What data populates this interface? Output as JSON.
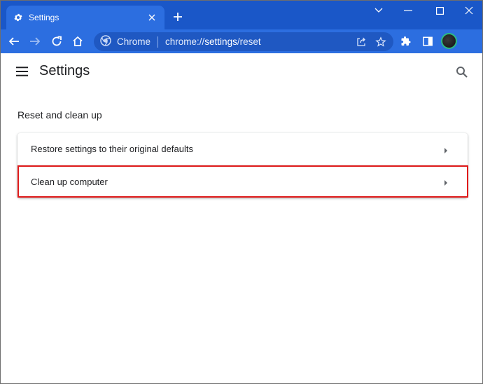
{
  "tab": {
    "title": "Settings",
    "icon": "gear-icon"
  },
  "window_controls": {
    "dropdown": "chevron-down-icon",
    "minimize": "minimize-icon",
    "maximize": "maximize-icon",
    "close": "close-icon"
  },
  "omnibox": {
    "site_chip": "Chrome",
    "url_prefix": "chrome://",
    "url_host": "settings",
    "url_path": "/reset"
  },
  "header": {
    "title": "Settings"
  },
  "section": {
    "title": "Reset and clean up",
    "items": [
      {
        "label": "Restore settings to their original defaults"
      },
      {
        "label": "Clean up computer"
      }
    ]
  },
  "colors": {
    "tabstrip": "#1a57c8",
    "toolbar": "#2c6ee0",
    "highlight": "#e01b1b"
  }
}
